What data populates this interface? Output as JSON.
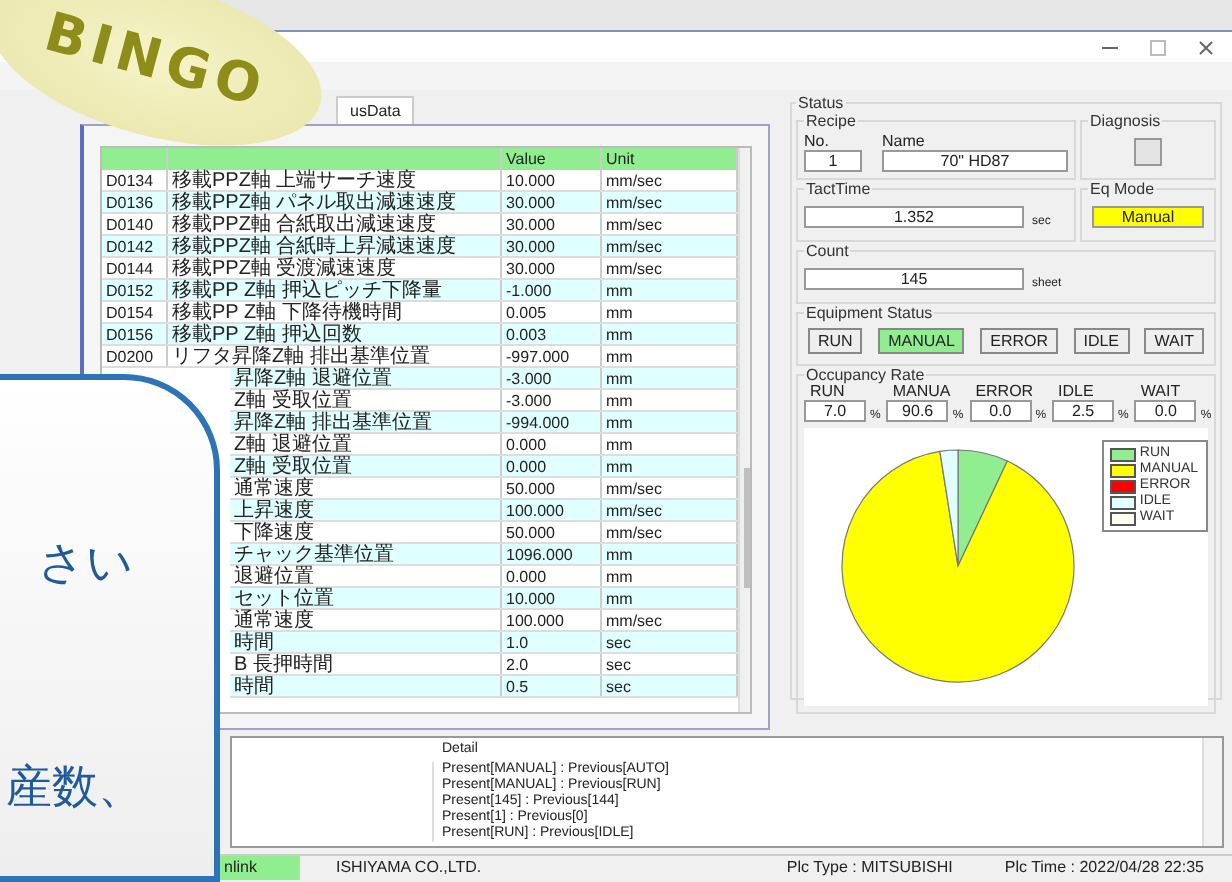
{
  "overlay_logo": {
    "text": "BINGO"
  },
  "callout": {
    "lines": [
      "さい",
      "産数、"
    ]
  },
  "tabs": [
    {
      "label": "usData",
      "selected": true
    }
  ],
  "table": {
    "columns": [
      "Value",
      "Unit"
    ],
    "rows": [
      {
        "id": "D0134",
        "name": "移載PPZ軸 上端サーチ速度",
        "value": "10.000",
        "unit": "mm/sec"
      },
      {
        "id": "D0136",
        "name": "移載PPZ軸 パネル取出減速速度",
        "value": "30.000",
        "unit": "mm/sec"
      },
      {
        "id": "D0140",
        "name": "移載PPZ軸 合紙取出減速速度",
        "value": "30.000",
        "unit": "mm/sec"
      },
      {
        "id": "D0142",
        "name": "移載PPZ軸 合紙時上昇減速速度",
        "value": "30.000",
        "unit": "mm/sec"
      },
      {
        "id": "D0144",
        "name": "移載PPZ軸 受渡減速速度",
        "value": "30.000",
        "unit": "mm/sec"
      },
      {
        "id": "D0152",
        "name": "移載PP Z軸 押込ピッチ下降量",
        "value": "-1.000",
        "unit": "mm"
      },
      {
        "id": "D0154",
        "name": "移載PP Z軸 下降待機時間",
        "value": "0.005",
        "unit": "mm"
      },
      {
        "id": "D0156",
        "name": "移載PP Z軸 押込回数",
        "value": "0.003",
        "unit": "mm"
      },
      {
        "id": "D0200",
        "name": "リフタ昇降Z軸 排出基準位置",
        "value": "-997.000",
        "unit": "mm"
      },
      {
        "name": "昇降Z軸 退避位置",
        "value": "-3.000",
        "unit": "mm"
      },
      {
        "name": "Z軸 受取位置",
        "value": "-3.000",
        "unit": "mm"
      },
      {
        "name": "昇降Z軸 排出基準位置",
        "value": "-994.000",
        "unit": "mm"
      },
      {
        "name": "Z軸 退避位置",
        "value": "0.000",
        "unit": "mm"
      },
      {
        "name": "Z軸 受取位置",
        "value": "0.000",
        "unit": "mm"
      },
      {
        "name": "通常速度",
        "value": "50.000",
        "unit": "mm/sec"
      },
      {
        "name": "上昇速度",
        "value": "100.000",
        "unit": "mm/sec"
      },
      {
        "name": "下降速度",
        "value": "50.000",
        "unit": "mm/sec"
      },
      {
        "name": "チャック基準位置",
        "value": "1096.000",
        "unit": "mm"
      },
      {
        "name": "退避位置",
        "value": "0.000",
        "unit": "mm"
      },
      {
        "name": "セット位置",
        "value": "10.000",
        "unit": "mm"
      },
      {
        "name": "通常速度",
        "value": "100.000",
        "unit": "mm/sec"
      },
      {
        "name": "時間",
        "value": "1.0",
        "unit": "sec"
      },
      {
        "name": "B 長押時間",
        "value": "2.0",
        "unit": "sec"
      },
      {
        "name": "時間",
        "value": "0.5",
        "unit": "sec"
      }
    ]
  },
  "status": {
    "title": "Status",
    "recipe": {
      "title": "Recipe",
      "no_label": "No.",
      "no": "1",
      "name_label": "Name",
      "name": "70\"  HD87"
    },
    "diagnosis": {
      "title": "Diagnosis",
      "on": false
    },
    "tact_time": {
      "title": "TactTime",
      "value": "1.352",
      "unit": "sec"
    },
    "eq_mode": {
      "title": "Eq Mode",
      "value": "Manual"
    },
    "count": {
      "title": "Count",
      "value": "145",
      "unit": "sheet"
    },
    "equipment_status": {
      "title": "Equipment Status",
      "buttons": [
        {
          "label": "RUN",
          "selected": false
        },
        {
          "label": "MANUAL",
          "selected": true
        },
        {
          "label": "ERROR",
          "selected": false
        },
        {
          "label": "IDLE",
          "selected": false
        },
        {
          "label": "WAIT",
          "selected": false
        }
      ]
    },
    "occupancy": {
      "title": "Occupancy Rate",
      "rates": [
        {
          "label": "RUN",
          "value": "7.0",
          "unit": "%"
        },
        {
          "label": "MANUA",
          "value": "90.6",
          "unit": "%"
        },
        {
          "label": "ERROR",
          "value": "0.0",
          "unit": "%"
        },
        {
          "label": "IDLE",
          "value": "2.5",
          "unit": "%"
        },
        {
          "label": "WAIT",
          "value": "0.0",
          "unit": "%"
        }
      ],
      "chart_data": {
        "type": "pie",
        "categories": [
          "RUN",
          "MANUAL",
          "ERROR",
          "IDLE",
          "WAIT"
        ],
        "values": [
          7.0,
          90.6,
          0.0,
          2.5,
          0.0
        ],
        "colors": [
          "#90ee90",
          "#ffff00",
          "#ff0000",
          "#e0ffff",
          "#fffff0"
        ],
        "legend": "right"
      }
    }
  },
  "log": {
    "columns": [
      "Detail"
    ],
    "rows": [
      "Present[MANUAL] : Previous[AUTO]",
      "Present[MANUAL] : Previous[RUN]",
      "Present[145] : Previous[144]",
      "Present[1] : Previous[0]",
      "Present[RUN] : Previous[IDLE]"
    ]
  },
  "status_bar": [
    {
      "text": "nlink",
      "highlight": true
    },
    {
      "text": "ISHIYAMA CO.,LTD.",
      "highlight": false
    },
    {
      "text": "Plc Type : MITSUBISHI",
      "highlight": false
    },
    {
      "text": "Plc Time : 2022/04/28 22:35",
      "highlight": false
    }
  ]
}
